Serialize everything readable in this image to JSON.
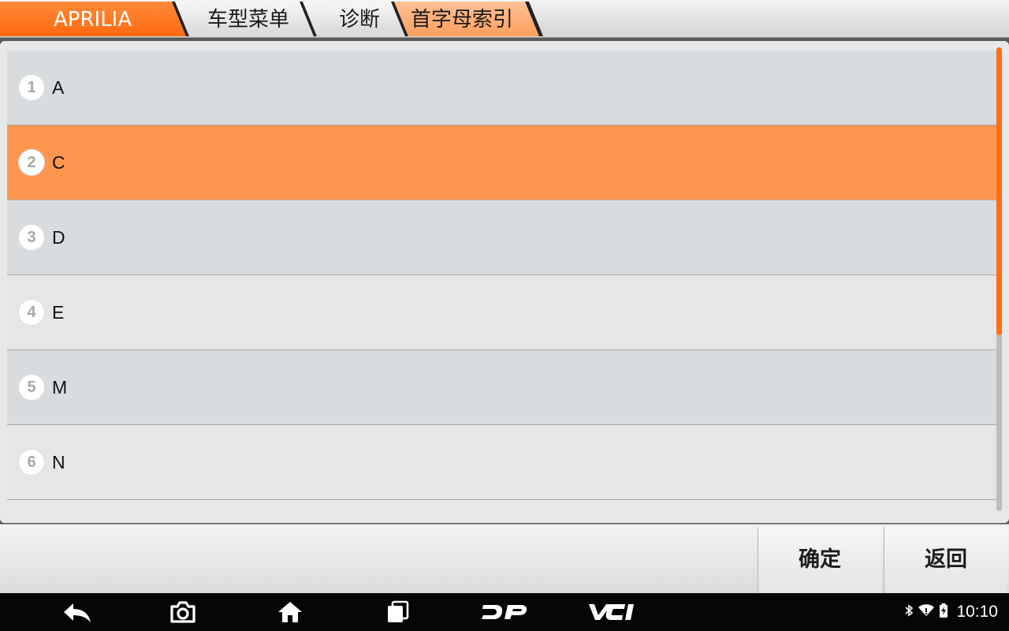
{
  "breadcrumbs": [
    {
      "label": "APRILIA",
      "active": true
    },
    {
      "label": "车型菜单",
      "active": false
    },
    {
      "label": "诊断",
      "active": false
    },
    {
      "label": "首字母索引",
      "active": false,
      "current": true
    }
  ],
  "list": {
    "items": [
      {
        "index": "1",
        "label": "A"
      },
      {
        "index": "2",
        "label": "C",
        "selected": true
      },
      {
        "index": "3",
        "label": "D"
      },
      {
        "index": "4",
        "label": "E"
      },
      {
        "index": "5",
        "label": "M"
      },
      {
        "index": "6",
        "label": "N"
      }
    ]
  },
  "toolbar": {
    "confirm_label": "确定",
    "back_label": "返回"
  },
  "navbar": {
    "icons": [
      "back-arrow-icon",
      "camera-icon",
      "home-icon",
      "recent-apps-icon",
      "dp-logo-icon",
      "vci-icon"
    ]
  },
  "status_bar": {
    "time": "10:10",
    "icons": [
      "bluetooth-icon",
      "wifi-icon",
      "battery-icon"
    ]
  },
  "colors": {
    "accent": "#ff6f16",
    "selected_row": "#ff9650",
    "crumb_current": "#ffb07a"
  }
}
